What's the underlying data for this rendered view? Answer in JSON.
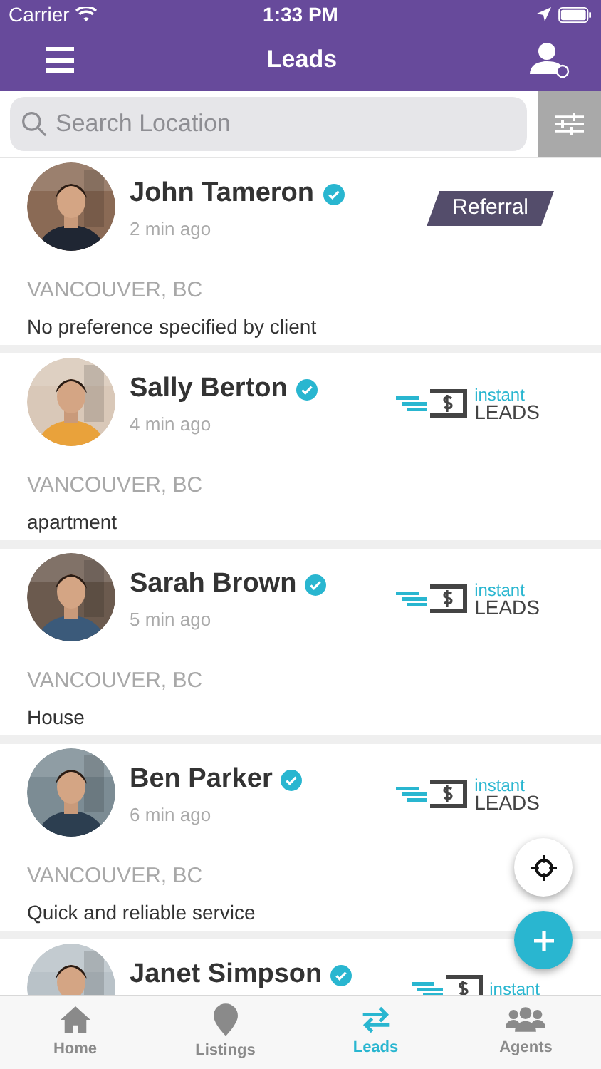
{
  "status_bar": {
    "carrier": "Carrier",
    "time": "1:33 PM"
  },
  "header": {
    "title": "Leads"
  },
  "search": {
    "placeholder": "Search Location"
  },
  "leads": [
    {
      "name": "John Tameron",
      "verified": true,
      "time": "2 min ago",
      "badge": {
        "kind": "referral",
        "label": "Referral"
      },
      "location": "VANCOUVER, BC",
      "note": "No preference specified by client"
    },
    {
      "name": "Sally Berton",
      "verified": true,
      "time": "4 min ago",
      "badge": {
        "kind": "instant_leads",
        "top": "instant",
        "bottom": "LEADS"
      },
      "location": "VANCOUVER, BC",
      "note": "apartment"
    },
    {
      "name": "Sarah Brown",
      "verified": true,
      "time": "5 min ago",
      "badge": {
        "kind": "instant_leads",
        "top": "instant",
        "bottom": "LEADS"
      },
      "location": "VANCOUVER, BC",
      "note": "House"
    },
    {
      "name": "Ben Parker",
      "verified": true,
      "time": "6 min ago",
      "badge": {
        "kind": "instant_leads",
        "top": "instant",
        "bottom": "LEADS"
      },
      "location": "VANCOUVER, BC",
      "note": "Quick and reliable service"
    },
    {
      "name": "Janet Simpson",
      "verified": true,
      "badge": {
        "kind": "instant_leads",
        "top": "instant"
      }
    }
  ],
  "tabs": [
    {
      "label": "Home",
      "kind": "home",
      "selected": false
    },
    {
      "label": "Listings",
      "kind": "pin",
      "selected": false
    },
    {
      "label": "Leads",
      "kind": "swap",
      "selected": true
    },
    {
      "label": "Agents",
      "kind": "people",
      "selected": false
    }
  ]
}
